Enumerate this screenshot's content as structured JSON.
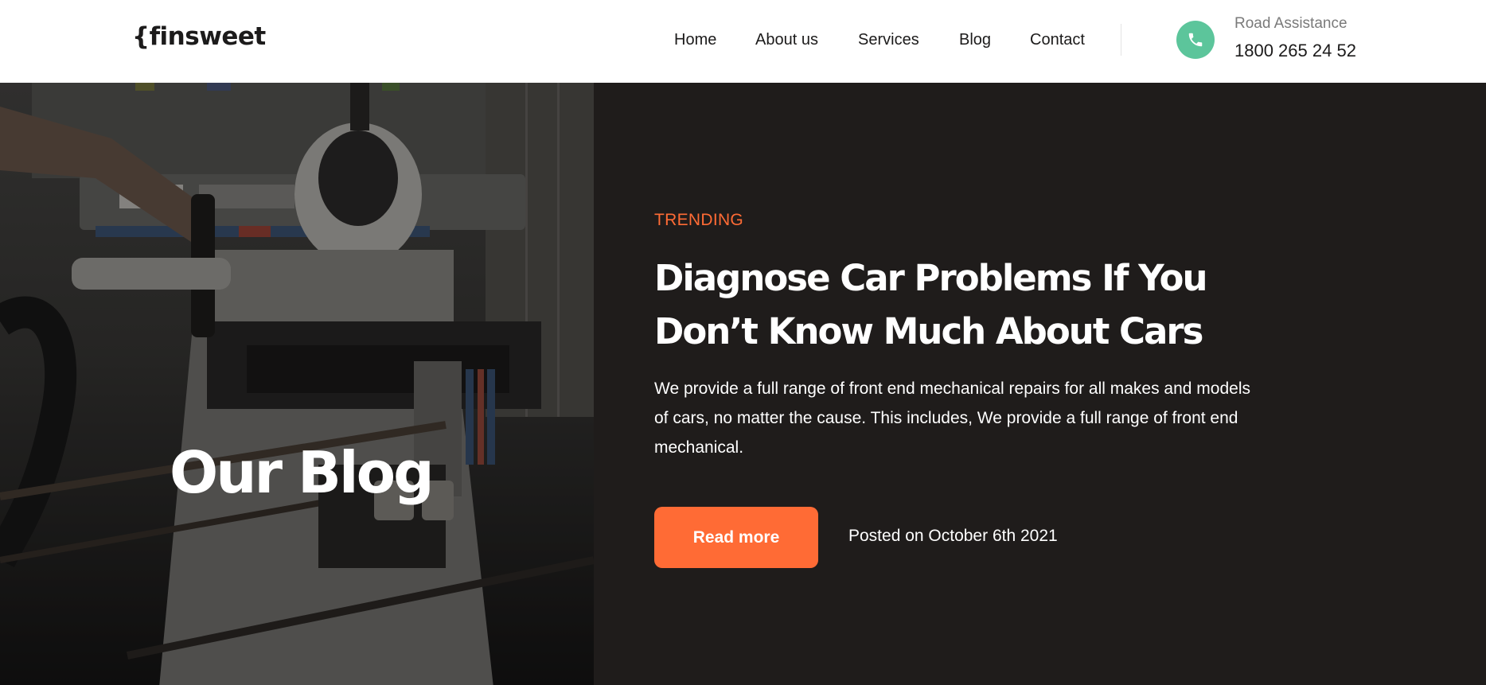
{
  "brand": {
    "logo_text": "{finsweet"
  },
  "nav": {
    "items": [
      {
        "label": "Home"
      },
      {
        "label": "About us"
      },
      {
        "label": "Services"
      },
      {
        "label": "Blog"
      },
      {
        "label": "Contact"
      }
    ]
  },
  "contact": {
    "label": "Road Assistance",
    "phone": "1800 265 24 52",
    "icon": "phone-icon",
    "accent_color": "#5cc59b"
  },
  "hero": {
    "title": "Our Blog"
  },
  "featured_post": {
    "eyebrow": "TRENDING",
    "title": "Diagnose Car Problems If You Don’t Know Much About Cars",
    "excerpt": "We provide a full range of front end mechanical repairs for all makes and models of cars, no matter the cause. This includes, We provide a full range of front end mechanical.",
    "cta_label": "Read more",
    "posted": "Posted on October 6th 2021"
  },
  "colors": {
    "accent": "#ff6b35",
    "dark_bg": "#1f1c1b",
    "header_bg": "#ffffff"
  }
}
